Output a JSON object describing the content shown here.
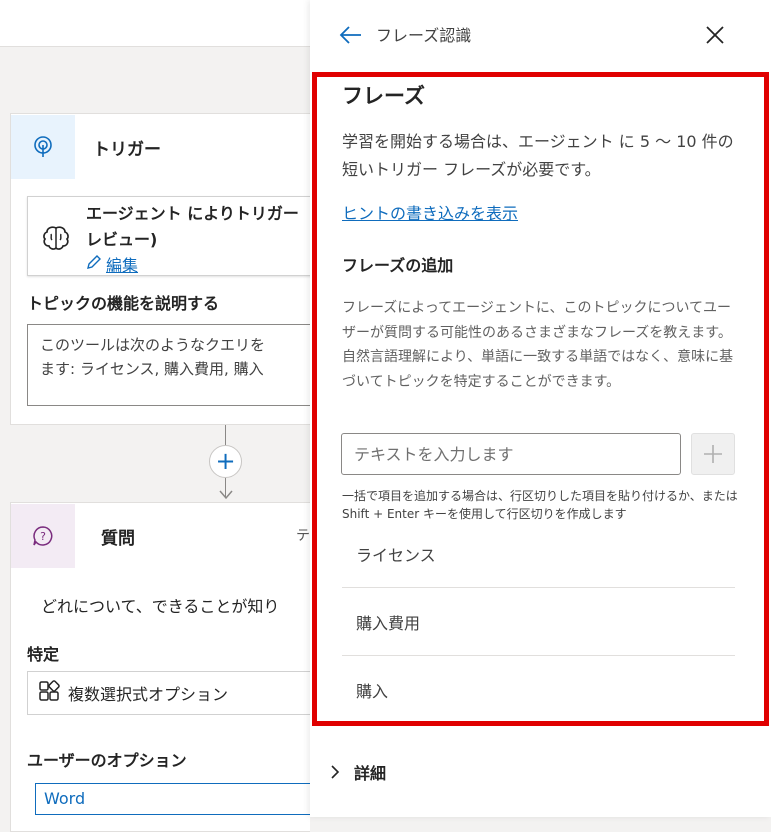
{
  "canvas": {
    "trigger_card": {
      "title": "トリガー",
      "inner_title_line1": "エージェント によりトリガー",
      "inner_title_line2": "レビュー)",
      "edit_label": "編集",
      "describe_label": "トピックの機能を説明する",
      "description_line1": "このツールは次のようなクエリを",
      "description_line2": "ます: ライセンス, 購入費用, 購入"
    },
    "question_card": {
      "title": "質問",
      "extra": "テ",
      "question_text": "どれについて、できることが知り",
      "identify_label": "特定",
      "select_value": "複数選択式オプション",
      "user_options_label": "ユーザーのオプション",
      "option_value": "Word"
    }
  },
  "panel": {
    "title": "フレーズ認識",
    "section_title": "フレーズ",
    "section_desc": "学習を開始する場合は、エージェント に 5 〜 10 件の短いトリガー フレーズが必要です。",
    "hint_link": "ヒントの書き込みを表示",
    "add_title": "フレーズの追加",
    "add_desc": "フレーズによってエージェントに、このトピックについてユーザーが質問する可能性のあるさまざまなフレーズを教えます。自然言語理解により、単語に一致する単語ではなく、意味に基づいてトピックを特定することができます。",
    "input_placeholder": "テキストを入力します",
    "small_hint": "一括で項目を追加する場合は、行区切りした項目を貼り付けるか、または Shift + Enter キーを使用して行区切りを作成します",
    "phrases": [
      "ライセンス",
      "購入費用",
      "購入"
    ],
    "details_label": "詳細"
  },
  "colors": {
    "accent": "#0f6cbd",
    "highlight_frame": "#e00000"
  },
  "icons": {
    "back": "arrow-left-icon",
    "close": "close-icon",
    "add": "plus-icon",
    "trigger": "trigger-icon",
    "agent": "brain-icon",
    "question": "question-icon",
    "edit": "pencil-icon",
    "select": "grid-icon",
    "expand": "chevron-right-icon"
  }
}
